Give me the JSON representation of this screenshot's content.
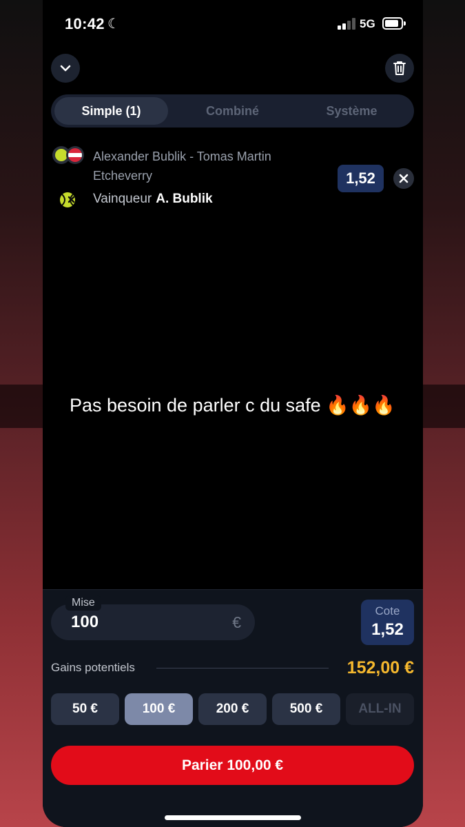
{
  "status_bar": {
    "time": "10:42",
    "network": "5G"
  },
  "header": {
    "collapse_icon": "chevron-down-icon",
    "delete_icon": "trash-icon"
  },
  "tabs": [
    {
      "label": "Simple (1)",
      "active": true
    },
    {
      "label": "Combiné",
      "active": false
    },
    {
      "label": "Système",
      "active": false
    }
  ],
  "bet": {
    "match": "Alexander Bublik - Tomas Martin Etcheverry",
    "selection_label": "Vainqueur",
    "selection_value": "A. Bublik",
    "odds": "1,52",
    "sport_icon": "tennis-ball-icon",
    "flag_icon": "austria-flag-icon",
    "market_icon": "market-tennis-icon"
  },
  "caption": "Pas besoin de parler c du safe 🔥🔥🔥",
  "stake": {
    "label": "Mise",
    "value": "100",
    "currency": "€",
    "cote_label": "Cote",
    "cote_value": "1,52",
    "potential_label": "Gains potentiels",
    "potential_value": "152,00 €"
  },
  "quick_stakes": [
    {
      "label": "50 €",
      "active": false
    },
    {
      "label": "100 €",
      "active": true
    },
    {
      "label": "200 €",
      "active": false
    },
    {
      "label": "500 €",
      "active": false
    },
    {
      "label": "ALL-IN",
      "active": false,
      "disabled": true
    }
  ],
  "place_bet_label": "Parier 100,00 €",
  "colors": {
    "accent_red": "#e20c19",
    "gain_yellow": "#f5b82e",
    "odds_blue": "#1f3260"
  }
}
